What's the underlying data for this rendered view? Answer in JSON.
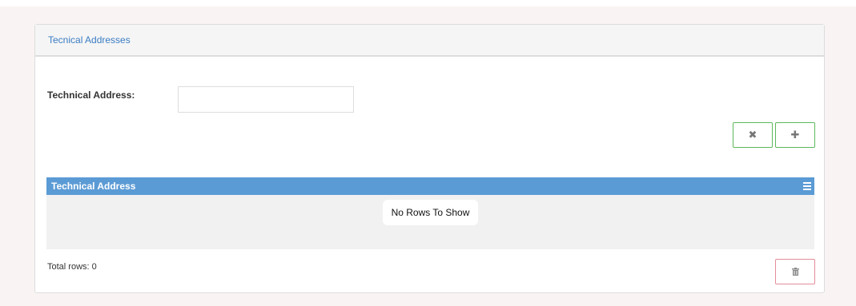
{
  "panel": {
    "title": "Tecnical Addresses"
  },
  "form": {
    "technical_address_label": "Technical Address:",
    "technical_address_value": "",
    "technical_address_placeholder": ""
  },
  "buttons": {
    "clear_icon": "close-icon",
    "add_icon": "plus-icon",
    "delete_icon": "trash-icon",
    "clear_glyph": "✖",
    "add_glyph": "✚"
  },
  "grid": {
    "columns": [
      "Technical Address"
    ],
    "rows": [],
    "empty_message": "No Rows To Show",
    "menu_icon": "menu-icon"
  },
  "footer": {
    "total_rows": "Total rows: 0"
  },
  "colors": {
    "accent": "#3a7cc3",
    "grid_header": "#5b9bd5",
    "success_border": "#5cb85c",
    "danger_border": "#e38d99"
  }
}
